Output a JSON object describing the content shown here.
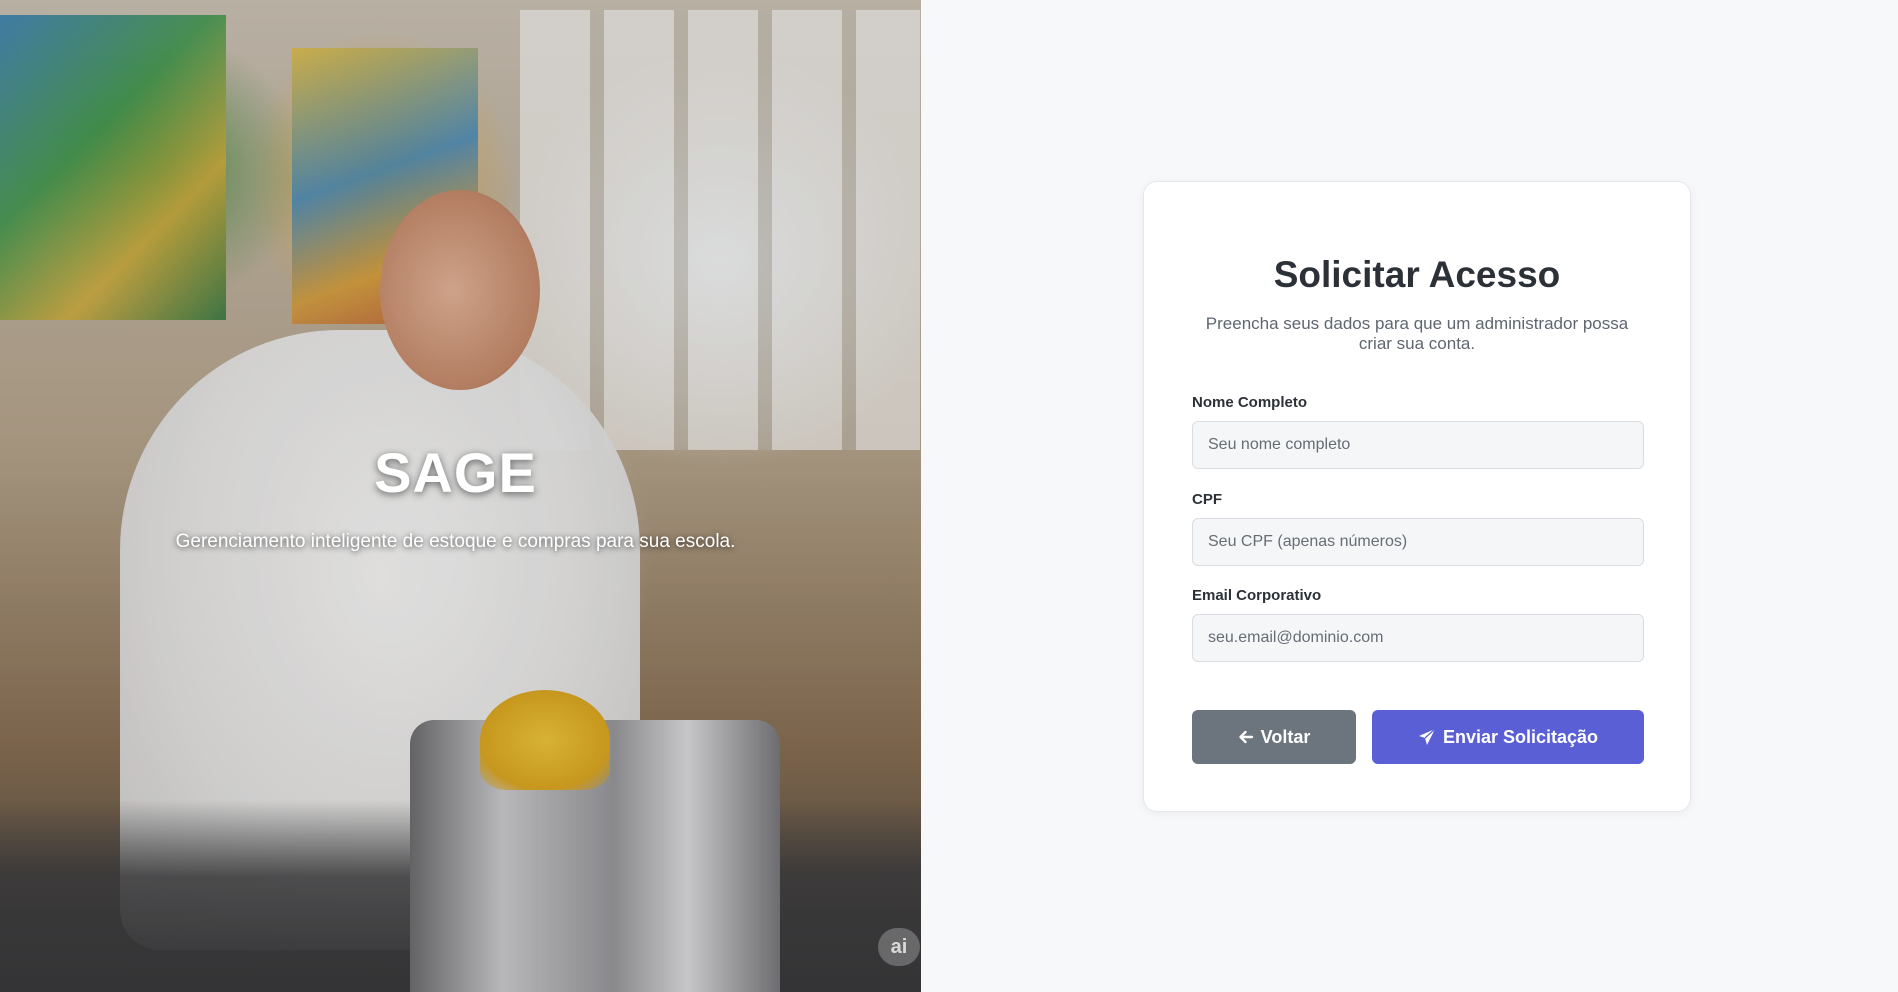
{
  "hero": {
    "title": "SAGE",
    "subtitle": "Gerenciamento inteligente de estoque e compras para sua escola.",
    "ai_badge": "ai"
  },
  "form": {
    "title": "Solicitar Acesso",
    "subtitle": "Preencha seus dados para que um administrador possa criar sua conta.",
    "fields": [
      {
        "label": "Nome Completo",
        "value": "",
        "placeholder": "Seu nome completo"
      },
      {
        "label": "CPF",
        "value": "",
        "placeholder": "Seu CPF (apenas números)"
      },
      {
        "label": "Email Corporativo",
        "value": "",
        "placeholder": "seu.email@dominio.com"
      }
    ],
    "buttons": {
      "back_label": "Voltar",
      "back_icon": "arrow-left-icon",
      "send_label": "Enviar Solicitação",
      "send_icon": "paper-plane-icon"
    }
  },
  "colors": {
    "primary": "#5a5fd6",
    "secondary": "#6c757d",
    "background": "#f7f8fa",
    "card": "#ffffff",
    "text": "#2c3138",
    "muted": "#5f6670"
  }
}
